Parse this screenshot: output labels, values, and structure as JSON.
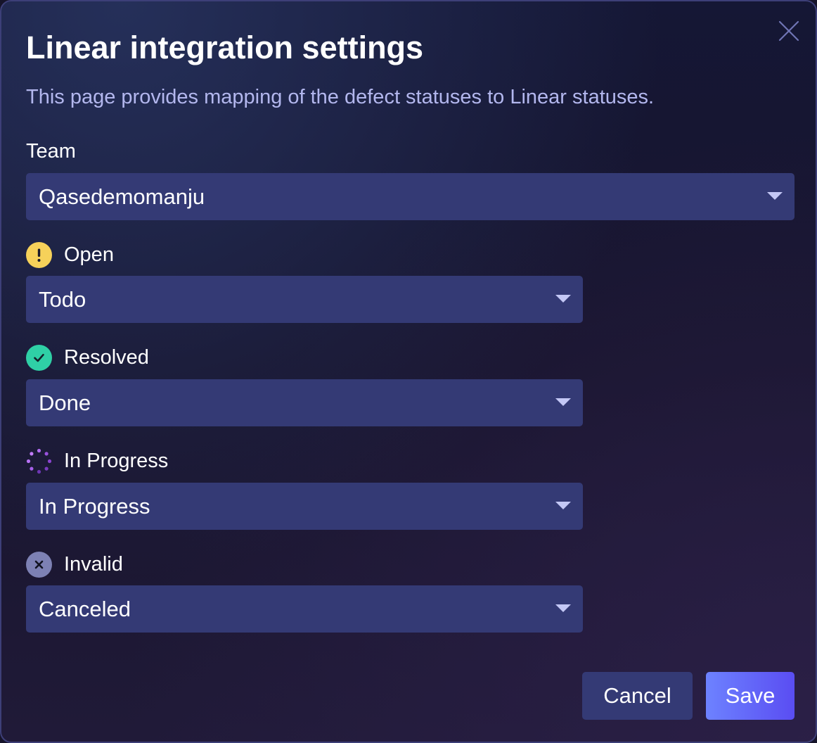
{
  "dialog": {
    "title": "Linear integration settings",
    "subtitle": "This page provides mapping of the defect statuses to Linear statuses.",
    "close_icon": "close-icon"
  },
  "team": {
    "label": "Team",
    "value": "Qasedemomanju"
  },
  "mappings": [
    {
      "status": "Open",
      "icon": "exclamation-circle-icon",
      "icon_color": "#f6d15a",
      "value": "Todo"
    },
    {
      "status": "Resolved",
      "icon": "check-circle-icon",
      "icon_color": "#2fd0a6",
      "value": "Done"
    },
    {
      "status": "In Progress",
      "icon": "dotted-spinner-icon",
      "icon_color": "#a35ee8",
      "value": "In Progress"
    },
    {
      "status": "Invalid",
      "icon": "x-circle-icon",
      "icon_color": "#7d81b4",
      "value": "Canceled"
    }
  ],
  "footer": {
    "cancel_label": "Cancel",
    "save_label": "Save"
  },
  "colors": {
    "select_background": "#343a75",
    "primary_gradient_start": "#6d82ff",
    "primary_gradient_end": "#5a4df2",
    "subtitle_text": "#b3b7ee"
  }
}
